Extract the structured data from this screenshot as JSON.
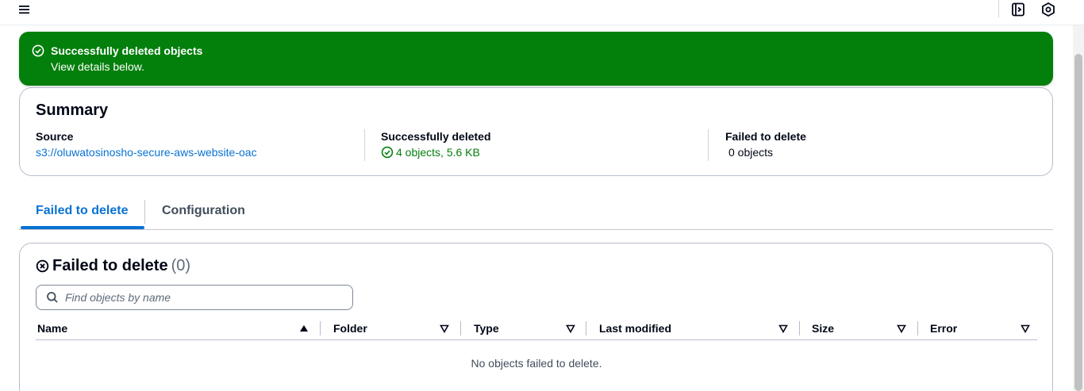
{
  "flash": {
    "title": "Successfully deleted objects",
    "subtitle": "View details below.",
    "color": "#037f0c"
  },
  "summary": {
    "title": "Summary",
    "source": {
      "label": "Source",
      "value": "s3://oluwatosinosho-secure-aws-website-oac"
    },
    "deleted": {
      "label": "Successfully deleted",
      "value": "4 objects, 5.6 KB"
    },
    "failed": {
      "label": "Failed to delete",
      "value": "0 objects"
    }
  },
  "tabs": [
    {
      "label": "Failed to delete",
      "active": true
    },
    {
      "label": "Configuration",
      "active": false
    }
  ],
  "failed_panel": {
    "title": "Failed to delete",
    "count": "(0)",
    "search_placeholder": "Find objects by name",
    "columns": [
      "Name",
      "Folder",
      "Type",
      "Last modified",
      "Size",
      "Error"
    ],
    "empty_message": "No objects failed to delete."
  },
  "icons": {
    "menu": "hamburger-menu-icon",
    "notifications": "notification-panel-icon",
    "settings": "hexagon-settings-icon",
    "success": "check-circle-icon",
    "error": "x-circle-icon",
    "search": "search-icon",
    "sort_asc": "caret-up-icon",
    "sort": "caret-down-icon"
  },
  "colors": {
    "link": "#0972d3",
    "success": "#037f0c"
  }
}
